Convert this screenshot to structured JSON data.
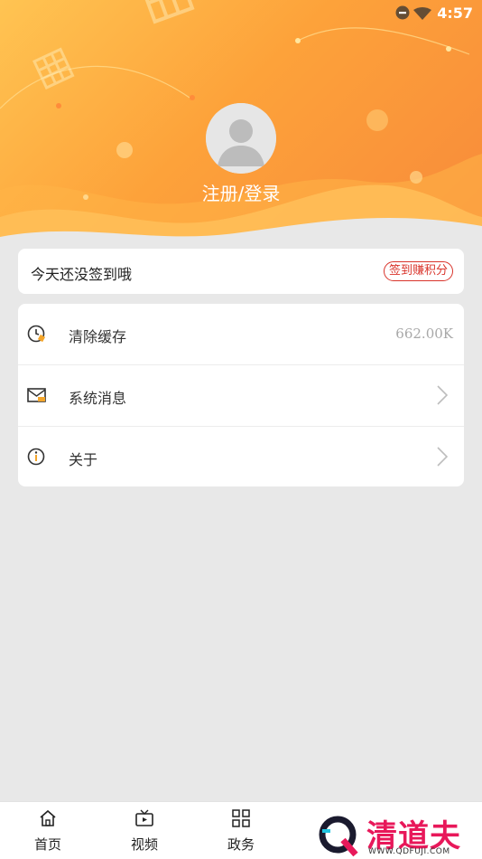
{
  "status_bar": {
    "time": "4:57"
  },
  "profile": {
    "login_text": "注册/登录"
  },
  "checkin": {
    "text": "今天还没签到哦",
    "button": "签到赚积分"
  },
  "menu": {
    "items": [
      {
        "label": "清除缓存",
        "value": "662.00K",
        "icon": "clock-broom-icon"
      },
      {
        "label": "系统消息",
        "icon": "envelope-icon"
      },
      {
        "label": "关于",
        "icon": "info-icon"
      }
    ]
  },
  "bottom_nav": {
    "items": [
      {
        "label": "首页",
        "icon": "home-icon"
      },
      {
        "label": "视频",
        "icon": "tv-icon"
      },
      {
        "label": "政务",
        "icon": "grid-icon"
      }
    ]
  },
  "watermark": {
    "text": "清道夫",
    "url": "WWW.QDFUJI.COM"
  },
  "colors": {
    "accent": "#fda23a",
    "checkin_red": "#d9342b",
    "watermark": "#e8185a"
  }
}
